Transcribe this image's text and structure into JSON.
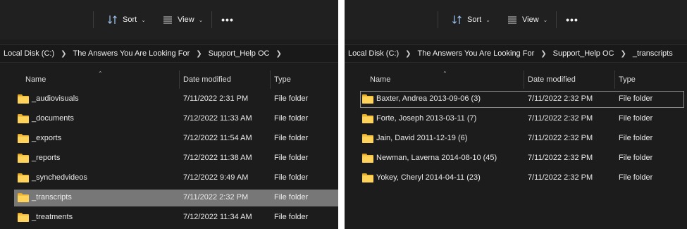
{
  "toolbar": {
    "sort_label": "Sort",
    "view_label": "View",
    "more_label": "•••"
  },
  "left": {
    "breadcrumb": [
      "Local Disk (C:)",
      "The Answers You Are Looking For",
      "Support_Help OC"
    ],
    "columns": {
      "name": "Name",
      "date": "Date modified",
      "type": "Type"
    },
    "rows": [
      {
        "name": "_audiovisuals",
        "date": "7/11/2022 2:31 PM",
        "type": "File folder"
      },
      {
        "name": "_documents",
        "date": "7/12/2022 11:33 AM",
        "type": "File folder"
      },
      {
        "name": "_exports",
        "date": "7/12/2022 11:54 AM",
        "type": "File folder"
      },
      {
        "name": "_reports",
        "date": "7/12/2022 11:38 AM",
        "type": "File folder"
      },
      {
        "name": "_synchedvideos",
        "date": "7/12/2022 9:49 AM",
        "type": "File folder"
      },
      {
        "name": "_transcripts",
        "date": "7/11/2022 2:32 PM",
        "type": "File folder",
        "selected": true
      },
      {
        "name": "_treatments",
        "date": "7/12/2022 11:34 AM",
        "type": "File folder"
      }
    ]
  },
  "right": {
    "breadcrumb": [
      "Local Disk (C:)",
      "The Answers You Are Looking For",
      "Support_Help OC",
      "_transcripts"
    ],
    "columns": {
      "name": "Name",
      "date": "Date modified",
      "type": "Type"
    },
    "rows": [
      {
        "name": "Baxter, Andrea 2013-09-06 (3)",
        "date": "7/11/2022 2:32 PM",
        "type": "File folder",
        "focused": true
      },
      {
        "name": "Forte, Joseph 2013-03-11 (7)",
        "date": "7/11/2022 2:32 PM",
        "type": "File folder"
      },
      {
        "name": "Jain, David 2011-12-19 (6)",
        "date": "7/11/2022 2:32 PM",
        "type": "File folder"
      },
      {
        "name": "Newman, Laverna 2014-08-10 (45)",
        "date": "7/11/2022 2:32 PM",
        "type": "File folder"
      },
      {
        "name": "Yokey, Cheryl 2014-04-11 (23)",
        "date": "7/11/2022 2:32 PM",
        "type": "File folder"
      }
    ]
  },
  "colors": {
    "pane_bg": "#1c1c1c",
    "toolbar_bg": "#202020",
    "selected_row": "#777777",
    "folder": "#f5c140"
  }
}
